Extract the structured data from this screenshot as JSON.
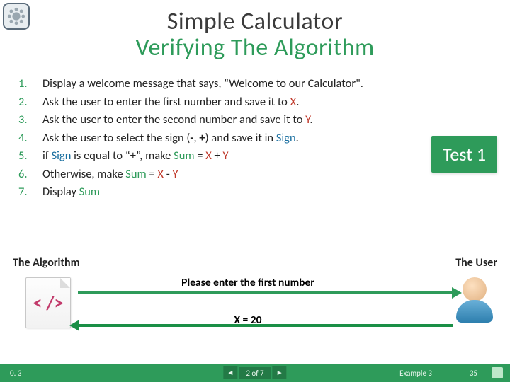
{
  "title": "Simple Calculator",
  "subtitle": "Verifying The Algorithm",
  "steps": [
    {
      "num": "1.",
      "html": "Display a welcome message that says, “Welcome to our Calculator\"."
    },
    {
      "num": "2.",
      "html": "Ask the user to enter the first number and save it to <span class='v-x'>X</span>."
    },
    {
      "num": "3.",
      "html": "Ask the user to enter the second number and save it to <span class='v-y'>Y</span>."
    },
    {
      "num": "4.",
      "html": "Ask the user to select the sign (<b>-</b>, <b>+</b>) and save it in <span class='v-sign'>Sign</span>."
    },
    {
      "num": "5.",
      "html": "if <span class='v-sign'>Sign</span> is equal to “+”, make <span class='v-sum'>Sum</span> = <span class='v-x'>X</span> + <span class='v-y'>Y</span>"
    },
    {
      "num": "6.",
      "html": "Otherwise, make <span class='v-sum'>Sum</span> = <span class='v-x'>X</span> - <span class='v-y'>Y</span>"
    },
    {
      "num": "7.",
      "html": "Display <span class='v-sum'>Sum</span>"
    }
  ],
  "test_badge": "Test 1",
  "labels": {
    "algorithm": "The Algorithm",
    "user": "The User"
  },
  "io": {
    "prompt": "Please enter the first number",
    "response": "X = 20"
  },
  "code_glyph": "< />",
  "footer": {
    "version": "0. 3",
    "page_of": "2 of 7",
    "example": "Example 3",
    "page": "35",
    "prev_glyph": "◄",
    "next_glyph": "►"
  }
}
